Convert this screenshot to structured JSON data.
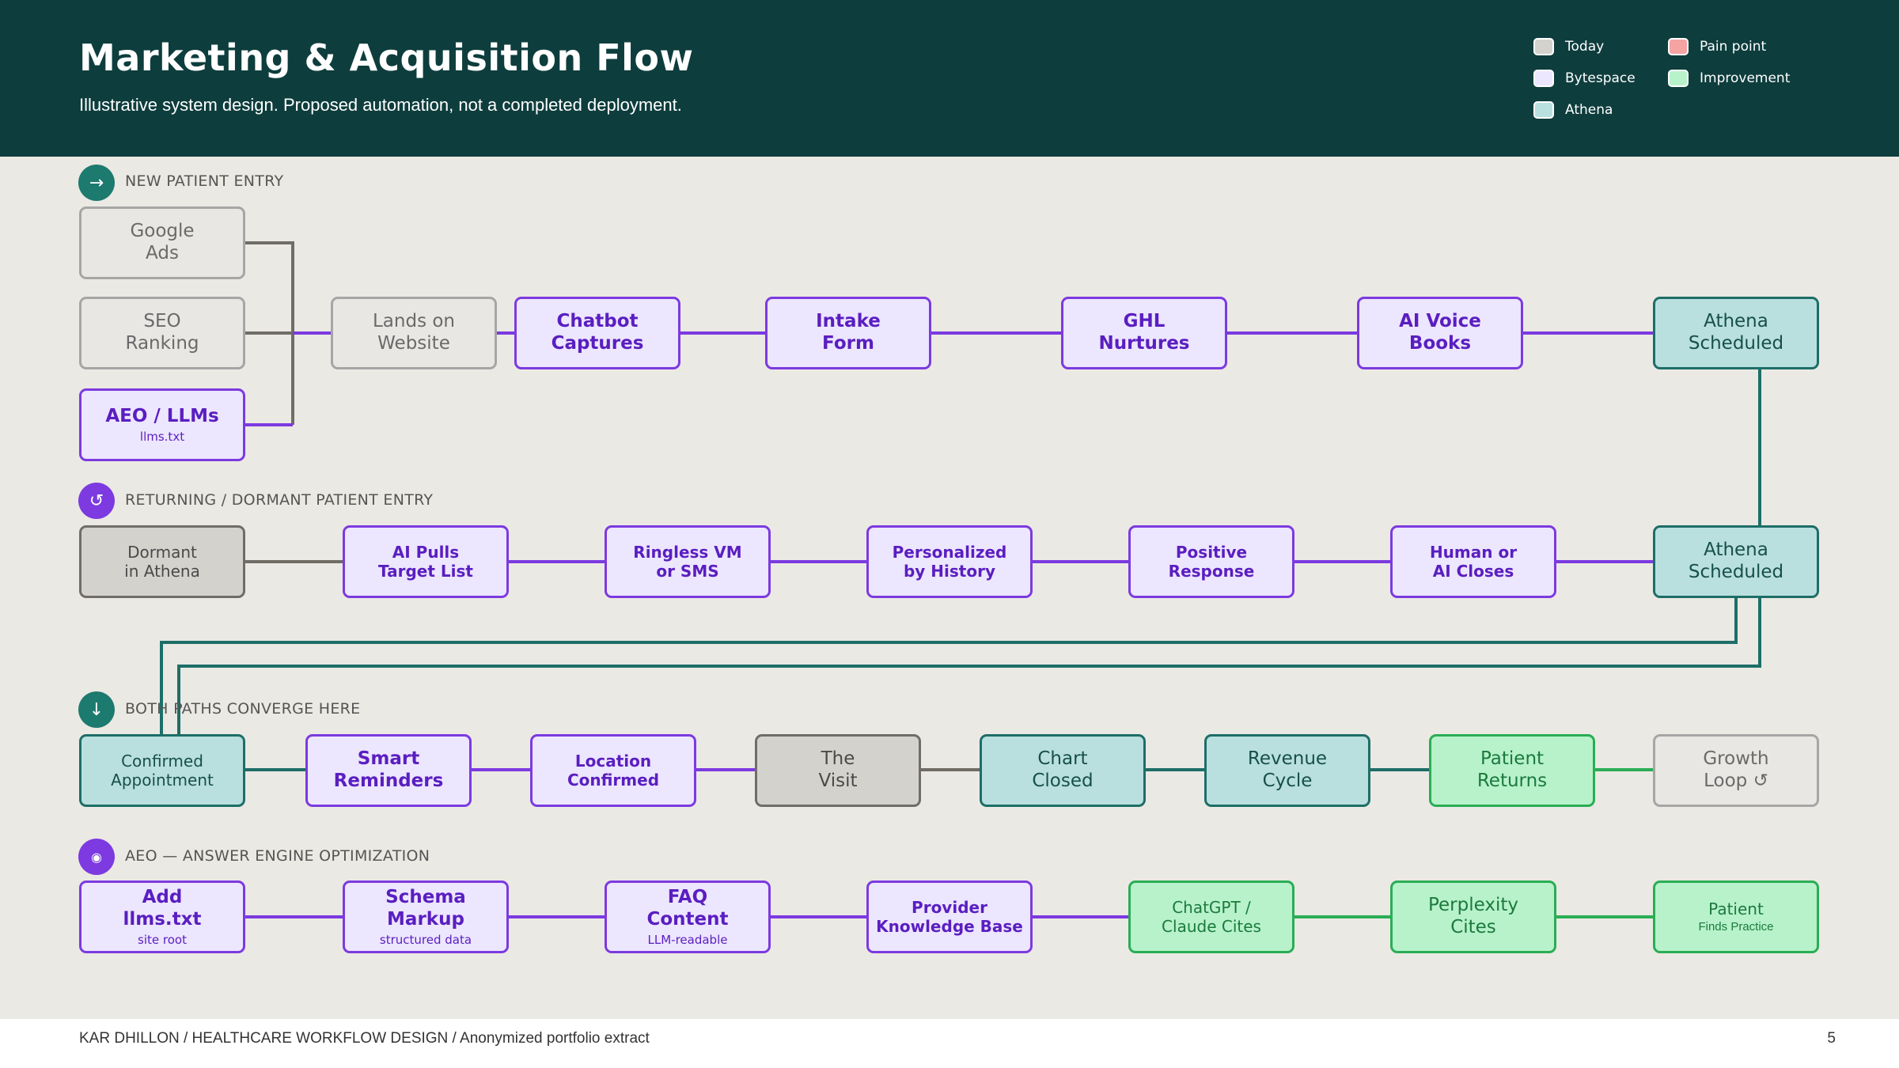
{
  "header": {
    "title": "Marketing & Acquisition Flow",
    "subtitle": "Illustrative system design. Proposed automation, not a completed deployment."
  },
  "legend": [
    {
      "label": "Today",
      "color": "#d4d2cc"
    },
    {
      "label": "Pain point",
      "color": "#f5a3a3"
    },
    {
      "label": "Bytespace",
      "color": "#ece6ff"
    },
    {
      "label": "Improvement",
      "color": "#b7f2cb"
    },
    {
      "label": "Athena",
      "color": "#b9e0de"
    }
  ],
  "colors": {
    "header_bg": "#0e3d3d",
    "bytespace_line": "#7c3ae0",
    "athena_line": "#1e6e68",
    "today_line": "#6f6d66",
    "improvement_line": "#2aad55"
  },
  "sections": {
    "new_entry": {
      "label": "NEW PATIENT ENTRY",
      "icon": "arrow-right-icon",
      "glyph": "→"
    },
    "returning": {
      "label": "RETURNING / DORMANT PATIENT ENTRY",
      "icon": "refresh-icon",
      "glyph": "↺"
    },
    "converge": {
      "label": "BOTH PATHS CONVERGE HERE",
      "icon": "arrow-down-icon",
      "glyph": "↓"
    },
    "aeo": {
      "label": "AEO — ANSWER ENGINE OPTIMIZATION",
      "icon": "target-icon",
      "glyph": "◉"
    }
  },
  "nodes": {
    "google_ads": {
      "label": "Google\nAds"
    },
    "seo_ranking": {
      "label": "SEO\nRanking"
    },
    "aeo_llms": {
      "label": "AEO / LLMs",
      "sub": "llms.txt"
    },
    "lands_on_website": {
      "label": "Lands on\nWebsite"
    },
    "chatbot_captures": {
      "label": "Chatbot\nCaptures"
    },
    "intake_form": {
      "label": "Intake\nForm"
    },
    "ghl_nurtures": {
      "label": "GHL\nNurtures"
    },
    "ai_voice_books": {
      "label": "AI Voice\nBooks"
    },
    "athena_scheduled_1": {
      "label": "Athena\nScheduled"
    },
    "dormant_in_athena": {
      "label": "Dormant\nin Athena"
    },
    "ai_pulls_target_list": {
      "label": "AI Pulls\nTarget List"
    },
    "ringless_vm": {
      "label": "Ringless VM\nor SMS"
    },
    "personalized": {
      "label": "Personalized\nby History"
    },
    "positive_response": {
      "label": "Positive\nResponse"
    },
    "human_or_ai_closes": {
      "label": "Human or\nAI Closes"
    },
    "athena_scheduled_2": {
      "label": "Athena\nScheduled"
    },
    "confirmed_appointment": {
      "label": "Confirmed\nAppointment"
    },
    "smart_reminders": {
      "label": "Smart\nReminders"
    },
    "location_confirmed": {
      "label": "Location\nConfirmed"
    },
    "the_visit": {
      "label": "The\nVisit"
    },
    "chart_closed": {
      "label": "Chart\nClosed"
    },
    "revenue_cycle": {
      "label": "Revenue\nCycle"
    },
    "patient_returns": {
      "label": "Patient\nReturns"
    },
    "growth_loop": {
      "label": "Growth\nLoop ↺"
    },
    "add_llms_txt": {
      "label": "Add\nllms.txt",
      "sub": "site root"
    },
    "schema_markup": {
      "label": "Schema\nMarkup",
      "sub": "structured data"
    },
    "faq_content": {
      "label": "FAQ\nContent",
      "sub": "LLM-readable"
    },
    "provider_kb": {
      "label": "Provider\nKnowledge Base"
    },
    "chatgpt_claude": {
      "label": "ChatGPT /\nClaude Cites"
    },
    "perplexity_cites": {
      "label": "Perplexity\nCites"
    },
    "patient_finds": {
      "label": "Patient",
      "sub": "Finds Practice"
    }
  },
  "footer": {
    "left": "KAR DHILLON / HEALTHCARE WORKFLOW DESIGN / Anonymized portfolio extract",
    "page": "5"
  }
}
